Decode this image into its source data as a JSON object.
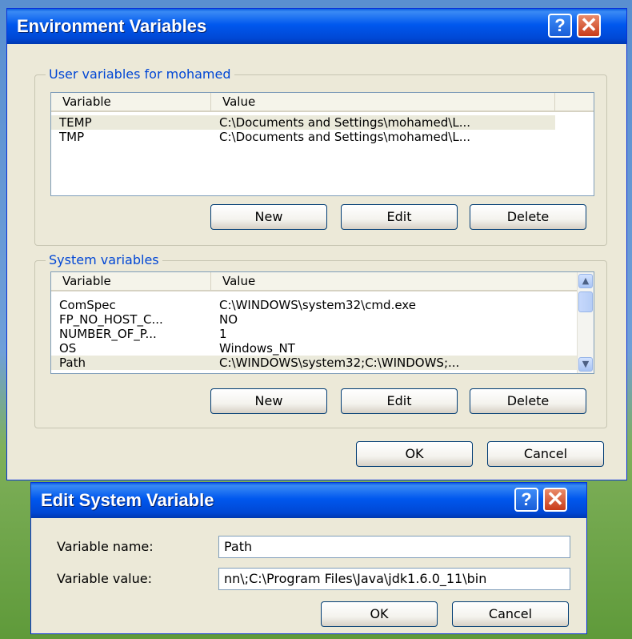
{
  "env_window": {
    "title": "Environment Variables",
    "help_glyph": "?",
    "close_glyph": "✕",
    "user_group": {
      "label": "User variables for mohamed",
      "columns": [
        "Variable",
        "Value"
      ],
      "rows": [
        {
          "variable": "TEMP",
          "value": "C:\\Documents and Settings\\mohamed\\L..."
        },
        {
          "variable": "TMP",
          "value": "C:\\Documents and Settings\\mohamed\\L..."
        }
      ],
      "buttons": {
        "new": "New",
        "edit": "Edit",
        "delete": "Delete"
      }
    },
    "system_group": {
      "label": "System variables",
      "columns": [
        "Variable",
        "Value"
      ],
      "rows": [
        {
          "variable": "ComSpec",
          "value": "C:\\WINDOWS\\system32\\cmd.exe"
        },
        {
          "variable": "FP_NO_HOST_C...",
          "value": "NO"
        },
        {
          "variable": "NUMBER_OF_P...",
          "value": "1"
        },
        {
          "variable": "OS",
          "value": "Windows_NT"
        },
        {
          "variable": "Path",
          "value": "C:\\WINDOWS\\system32;C:\\WINDOWS;..."
        }
      ],
      "buttons": {
        "new": "New",
        "edit": "Edit",
        "delete": "Delete"
      }
    },
    "ok_label": "OK",
    "cancel_label": "Cancel"
  },
  "edit_window": {
    "title": "Edit System Variable",
    "help_glyph": "?",
    "close_glyph": "✕",
    "name_label": "Variable name:",
    "name_value": "Path",
    "value_label": "Variable value:",
    "value_value": "nn\\;C:\\Program Files\\Java\\jdk1.6.0_11\\bin",
    "ok_label": "OK",
    "cancel_label": "Cancel"
  },
  "colors": {
    "titlebar": "#0058ee",
    "dialog_bg": "#ece9d8",
    "group_label": "#0046d5"
  }
}
